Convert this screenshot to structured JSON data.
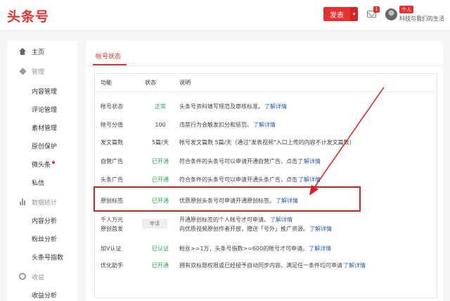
{
  "header": {
    "logo": "头条号",
    "publish_label": "发表",
    "mail_count": "1",
    "user_tag": "个人",
    "user_name": "科技与我们的生活"
  },
  "sidebar": {
    "items": [
      {
        "label": "主页",
        "kind": "top",
        "icon": "home-icon"
      },
      {
        "label": "管理",
        "kind": "section",
        "icon": "cube-icon"
      },
      {
        "label": "内容管理",
        "kind": "sub"
      },
      {
        "label": "评论管理",
        "kind": "sub"
      },
      {
        "label": "素材管理",
        "kind": "sub"
      },
      {
        "label": "原创保护",
        "kind": "sub"
      },
      {
        "label": "微头条",
        "kind": "sub"
      },
      {
        "label": "私信",
        "kind": "sub"
      },
      {
        "label": "数据统计",
        "kind": "section",
        "icon": "bar-chart-icon"
      },
      {
        "label": "内容分析",
        "kind": "sub"
      },
      {
        "label": "粉丝分析",
        "kind": "sub"
      },
      {
        "label": "头条号指数",
        "kind": "sub"
      },
      {
        "label": "收益",
        "kind": "section",
        "icon": "coin-icon"
      },
      {
        "label": "收益分析",
        "kind": "sub"
      }
    ]
  },
  "main": {
    "tab": "帐号状态",
    "table": {
      "headers": [
        "功能",
        "状态",
        "说明"
      ],
      "rows": [
        {
          "func": "帐号状态",
          "status": "正常",
          "status_color": "#27a94c",
          "desc": "头条号资料填写规范及审核标准。",
          "link": "了解详情"
        },
        {
          "func": "帐号分值",
          "status": "100",
          "status_color": "#444444",
          "desc": "违禁行为会触发扣分和惩罚。",
          "link": "了解详情"
        },
        {
          "func": "发文篇数",
          "status": "5篇/天",
          "status_color": "#444444",
          "desc": "帐号发文篇数 5篇/天（通过\"发表视频\"入口上传的内容不计发文篇数）",
          "link": ""
        },
        {
          "func": "自营广告",
          "status": "已开通",
          "status_color": "#27a94c",
          "desc": "符合条件的头条号可以申请开通自营广告，点击了",
          "link": "解详情"
        },
        {
          "func": "头条广告",
          "status": "已开通",
          "status_color": "#27a94c",
          "desc": "符合条件的头条号可以申请开通头条广告，点击",
          "link": "了解详情"
        },
        {
          "func": "原创标签",
          "status": "已开通",
          "status_color": "#27a94c",
          "desc": "优质原创头条号可申请开通原创标签。",
          "link": "了解详情"
        },
        {
          "func": "千人万元",
          "status": "",
          "status_color": "#444444",
          "desc": "开通原创标签的个人帐号才可申请。",
          "link": "了解详情"
        },
        {
          "func": "原创首发",
          "status": "申请",
          "status_color": "#777777",
          "desc": "向优质视频原创作者开放，赠送「号外」推广资源。",
          "link": "了解详情"
        },
        {
          "func": "加V认证",
          "status": "已认证",
          "status_color": "#27a94c",
          "desc": "粉丝>=1万，头条号指数>=600的帐号才可申请。",
          "link": "了解详情"
        },
        {
          "func": "优化助手",
          "status": "已开通",
          "status_color": "#27a94c",
          "desc": "拥有双标题权限或已经授予自动同步内容，满足任一条件均可申请",
          "link": "了解详情"
        }
      ]
    }
  },
  "annotation": {
    "highlight_color": "#e01e1e"
  }
}
